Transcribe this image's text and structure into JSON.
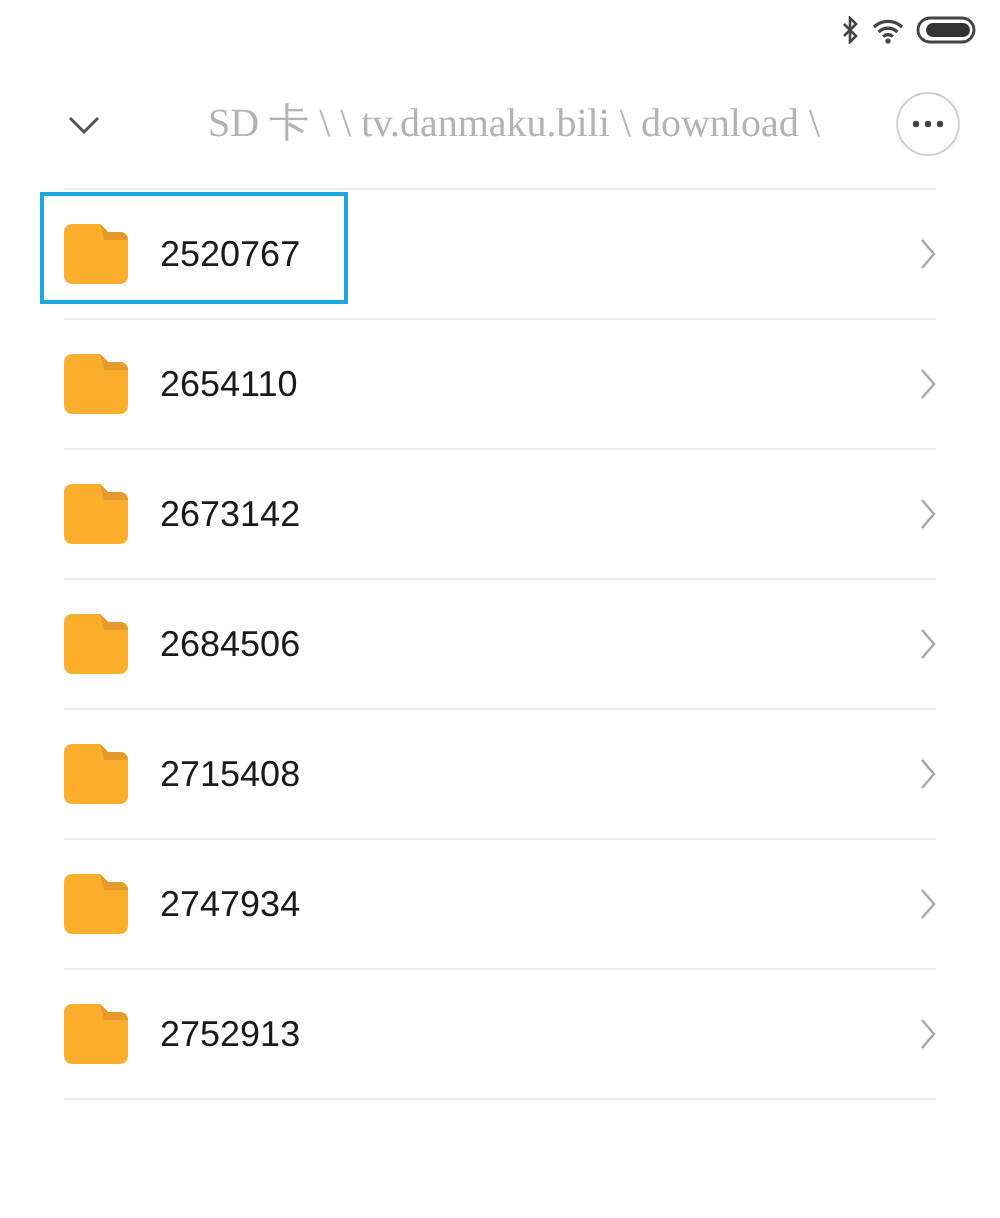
{
  "header": {
    "path": "SD 卡 \\ \\ tv.danmaku.bili \\ download \\"
  },
  "folders": [
    {
      "name": "2520767",
      "highlighted": true
    },
    {
      "name": "2654110",
      "highlighted": false
    },
    {
      "name": "2673142",
      "highlighted": false
    },
    {
      "name": "2684506",
      "highlighted": false
    },
    {
      "name": "2715408",
      "highlighted": false
    },
    {
      "name": "2747934",
      "highlighted": false
    },
    {
      "name": "2752913",
      "highlighted": false
    }
  ]
}
